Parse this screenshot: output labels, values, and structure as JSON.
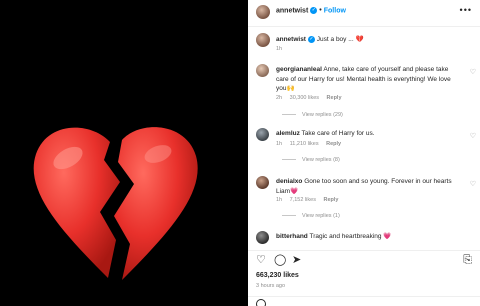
{
  "post": {
    "heart_color": "#e8302b"
  },
  "header": {
    "username": "annetwist",
    "verified_icon": "verified-badge-icon",
    "separator": "•",
    "follow_label": "Follow",
    "more_icon": "more-horizontal-icon"
  },
  "caption": {
    "username": "annetwist",
    "text": "Just a boy ...",
    "emoji": "💔",
    "time": "1h"
  },
  "comments": [
    {
      "username": "georgiananleal",
      "text": "Anne, take care of yourself and please take care of our Harry for us! Mental health is everything! We love you🙌",
      "time": "2h",
      "likes": "30,300 likes",
      "reply_label": "Reply",
      "view_replies": "View replies (29)"
    },
    {
      "username": "alemluz",
      "text": "Take care of Harry for us.",
      "time": "1h",
      "likes": "11,210 likes",
      "reply_label": "Reply",
      "view_replies": "View replies (8)"
    },
    {
      "username": "denialxo",
      "text": "Gone too soon and so young. Forever in our hearts Liam💗",
      "time": "1h",
      "likes": "7,152 likes",
      "reply_label": "Reply",
      "view_replies": "View replies (1)"
    },
    {
      "username": "bitterhand",
      "text": "Tragic and heartbreaking 💗",
      "time": "",
      "likes": "",
      "reply_label": "",
      "view_replies": ""
    }
  ],
  "footer": {
    "likes": "663,230 likes",
    "time_ago": "3 hours ago",
    "icons": [
      "heart-icon",
      "comment-icon",
      "share-icon",
      "save-icon"
    ]
  },
  "colors": {
    "accent": "#0095f6",
    "muted": "#8e8e8e"
  }
}
